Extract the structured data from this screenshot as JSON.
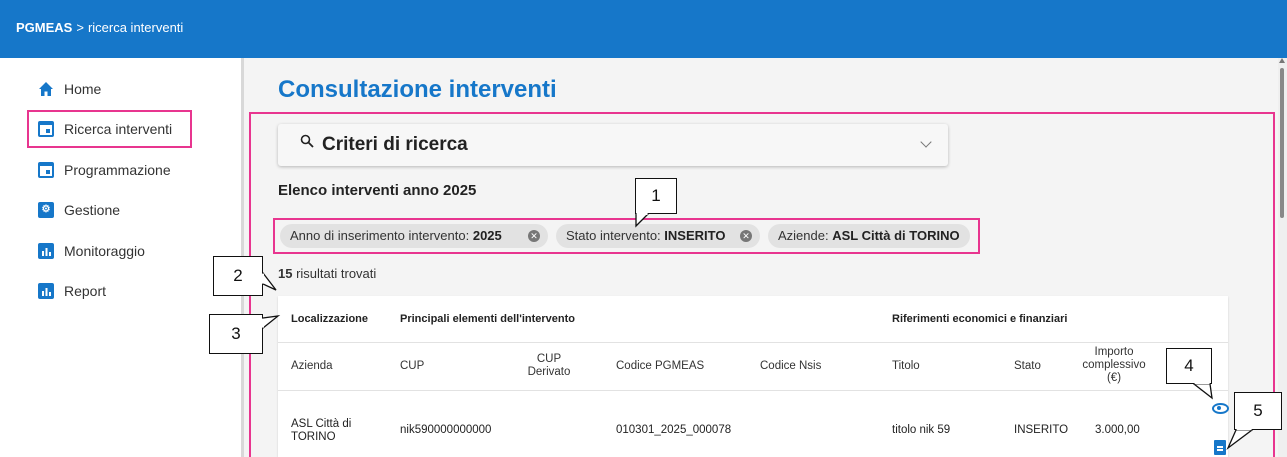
{
  "header": {
    "app": "PGMEAS",
    "separator": ">",
    "current": "ricerca interventi"
  },
  "sidebar": {
    "items": [
      {
        "label": "Home",
        "icon": "home-icon"
      },
      {
        "label": "Ricerca interventi",
        "icon": "calendar-icon",
        "selected": true
      },
      {
        "label": "Programmazione",
        "icon": "calendar-icon"
      },
      {
        "label": "Gestione",
        "icon": "settings-icon"
      },
      {
        "label": "Monitoraggio",
        "icon": "chart-icon"
      },
      {
        "label": "Report",
        "icon": "chart-icon"
      }
    ]
  },
  "main": {
    "page_title": "Consultazione interventi",
    "search_panel": {
      "title": "Criteri di ricerca"
    },
    "list_title": "Elenco interventi anno 2025",
    "filters": [
      {
        "label": "Anno di inserimento intervento:",
        "value": "2025",
        "removable": true
      },
      {
        "label": "Stato intervento:",
        "value": "INSERITO",
        "removable": true
      },
      {
        "label": "Aziende:",
        "value": "ASL Città di TORINO",
        "removable": false
      }
    ],
    "results": {
      "count": "15",
      "text": "risultati trovati"
    },
    "table": {
      "groups": [
        "Localizzazione",
        "Principali elementi dell'intervento",
        "Riferimenti economici e finanziari"
      ],
      "columns": [
        "Azienda",
        "CUP",
        "CUP Derivato",
        "Codice PGMEAS",
        "Codice Nsis",
        "Titolo",
        "Stato",
        "Importo complessivo (€)"
      ],
      "rows": [
        {
          "azienda": "ASL Città di TORINO",
          "cup": "nik590000000000",
          "cup_derivato": "",
          "codice_pgmeas": "010301_2025_000078",
          "codice_nsis": "",
          "titolo": "titolo nik 59",
          "stato": "INSERITO",
          "importo": "3.000,00"
        }
      ]
    }
  },
  "callouts": [
    "1",
    "2",
    "3",
    "4",
    "5"
  ],
  "colors": {
    "primary": "#1677c9",
    "highlight": "#e8358f",
    "chip": "#e2e2e2"
  }
}
